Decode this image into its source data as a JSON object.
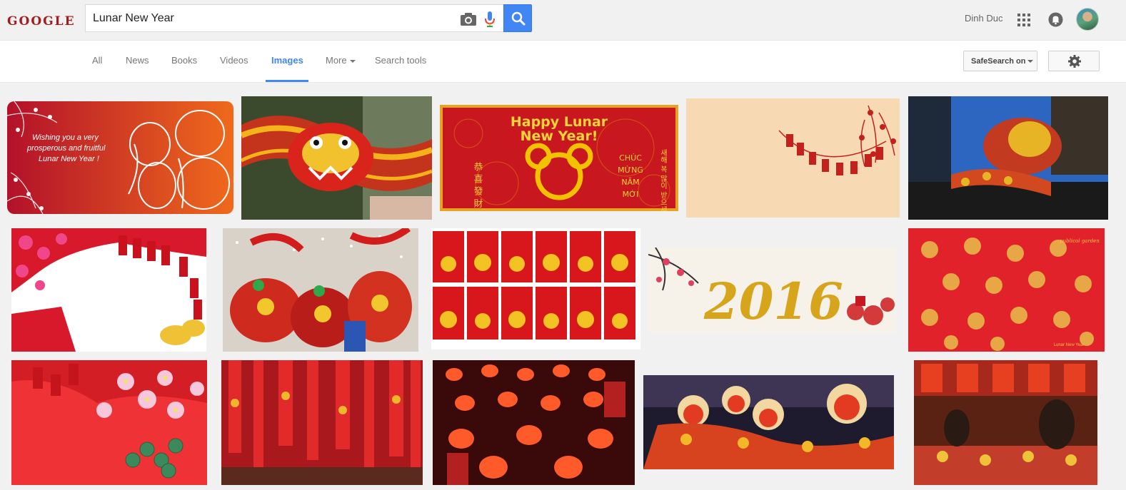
{
  "brand": {
    "logo_text": "GOOGLE"
  },
  "search": {
    "query": "Lunar New Year"
  },
  "user": {
    "name": "Dinh Duc"
  },
  "nav": {
    "tabs": [
      {
        "label": "All"
      },
      {
        "label": "News"
      },
      {
        "label": "Books"
      },
      {
        "label": "Videos"
      },
      {
        "label": "Images"
      },
      {
        "label": "More"
      },
      {
        "label": "Search tools"
      }
    ],
    "active_tab": "Images",
    "safesearch_label": "SafeSearch on"
  },
  "images": {
    "card1_line1": "Wishing you a very",
    "card1_line2": "prosperous and fruitful",
    "card1_line3": "Lunar New Year !",
    "card3_title1": "Happy Lunar",
    "card3_title2": "New Year!",
    "card3_left": "恭 喜 發 財",
    "card3_right1": "CHÚC",
    "card3_right2": "MỪNG",
    "card3_right3": "NĂM",
    "card3_right4": "MỚI",
    "card3_korean": "새해 복 많이 받으세요",
    "card9_year": "2016",
    "card10_brand": "publicol garden",
    "card10_caption": "Lunar New Year"
  },
  "colors": {
    "accent": "#4285f4",
    "logo": "#a31d1d",
    "festive_red": "#d81e1e",
    "gold": "#f2c200"
  }
}
